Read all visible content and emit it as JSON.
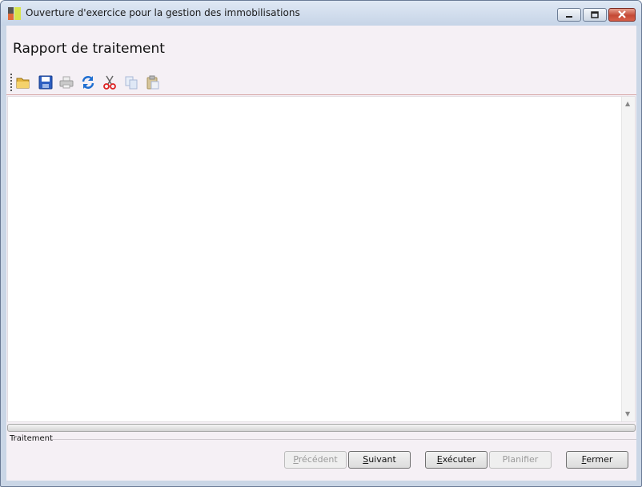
{
  "window": {
    "title": "Ouverture d'exercice pour la gestion des immobilisations",
    "controls": [
      "minimize-icon",
      "restore-icon",
      "close-icon"
    ]
  },
  "heading": "Rapport de traitement",
  "toolbar": {
    "buttons": [
      {
        "name": "open-folder-icon",
        "enabled": true
      },
      {
        "name": "save-icon",
        "enabled": true
      },
      {
        "name": "print-icon",
        "enabled": false
      },
      {
        "name": "refresh-icon",
        "enabled": true
      },
      {
        "name": "cut-icon",
        "enabled": true
      },
      {
        "name": "copy-icon",
        "enabled": false
      },
      {
        "name": "paste-icon",
        "enabled": false
      }
    ]
  },
  "editor": {
    "content": ""
  },
  "progress": {
    "value": 0
  },
  "status_group": {
    "label": "Traitement"
  },
  "buttons": {
    "precedent": {
      "mnemonic": "P",
      "rest": "récédent",
      "enabled": false
    },
    "suivant": {
      "mnemonic": "S",
      "rest": "uivant",
      "enabled": true
    },
    "executer": {
      "mnemonic": "E",
      "rest": "xécuter",
      "enabled": true
    },
    "planifier": {
      "mnemonic": "",
      "rest": "Planifier",
      "enabled": false
    },
    "fermer": {
      "mnemonic": "F",
      "rest": "ermer",
      "enabled": true
    }
  },
  "colors": {
    "client_bg": "#f5f0f5",
    "titlebar": "#c6d4e7",
    "close_button": "#c44a36",
    "toolbar_separator": "#d7a6a6"
  }
}
